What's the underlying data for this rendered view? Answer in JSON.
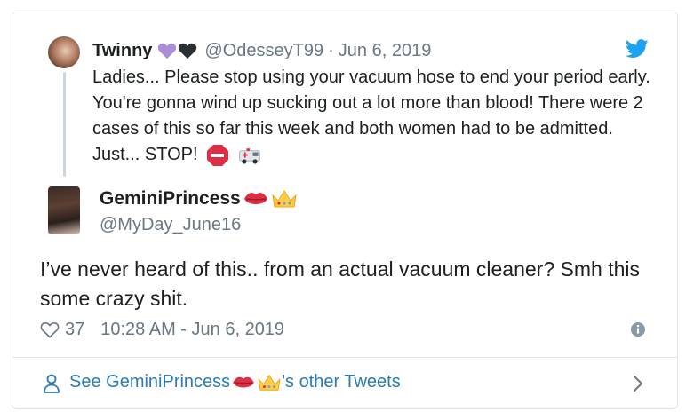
{
  "parent_tweet": {
    "display_name": "Twinny",
    "handle": "@OdesseyT99",
    "separator": "·",
    "date": "Jun 6, 2019",
    "text": "Ladies... Please stop using your vacuum hose to end your period early. You're gonna wind up sucking out a lot more than blood! There were 2 cases of this so far this week and both women had to be admitted. Just... STOP!",
    "name_emojis": [
      "purple-heart-icon",
      "black-heart-icon"
    ],
    "trailing_emojis": [
      "stop-sign-icon",
      "ambulance-icon"
    ]
  },
  "tweet": {
    "display_name": "GeminiPrincess",
    "handle": "@MyDay_June16",
    "name_emojis": [
      "lips-icon",
      "crown-icon"
    ],
    "text": "I’ve never heard of this.. from an actual vacuum cleaner? Smh this some crazy shit.",
    "like_count": "37",
    "timestamp": "10:28 AM - Jun 6, 2019"
  },
  "footer": {
    "link_prefix": "See GeminiPrincess",
    "link_suffix": "'s other Tweets"
  },
  "colors": {
    "link_blue": "#2b7bb9",
    "twitter_blue": "#1da1f2",
    "muted_text": "#697882",
    "border": "#e1e8ed"
  }
}
